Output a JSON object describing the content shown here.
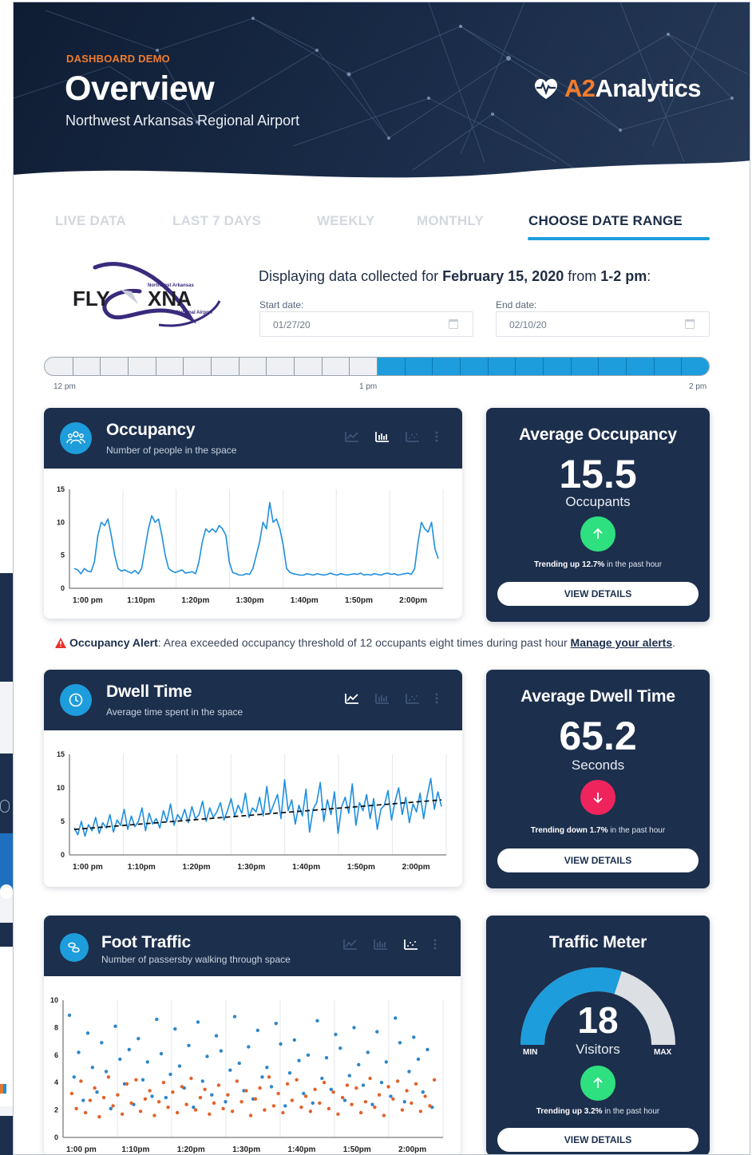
{
  "hero": {
    "eyebrow": "DASHBOARD DEMO",
    "title": "Overview",
    "subtitle": "Northwest Arkansas Regional Airport",
    "brand_prefix": "A2",
    "brand_suffix": "Analytics"
  },
  "tabs": [
    {
      "label": "LIVE DATA",
      "active": false
    },
    {
      "label": "LAST 7 DAYS",
      "active": false
    },
    {
      "label": "WEEKLY",
      "active": false
    },
    {
      "label": "MONTHLY",
      "active": false
    },
    {
      "label": "CHOOSE DATE RANGE",
      "active": true
    }
  ],
  "airport_logo": {
    "wordmark_left": "FLY",
    "wordmark_right": "XNA",
    "line1": "Northwest Arkansas",
    "line2": "National Airport"
  },
  "range": {
    "prefix": "Displaying data collected for ",
    "date": "February 15, 2020",
    "middle": " from ",
    "hours": "1-2 pm",
    "suffix": ":",
    "start_label": "Start date:",
    "start_value": "01/27/20",
    "end_label": "End date:",
    "end_value": "02/10/20"
  },
  "time_slider": {
    "labels": [
      "12 pm",
      "1 pm",
      "2 pm"
    ],
    "segments": 24,
    "selected_from": 12,
    "selected_to": 24
  },
  "occupancy": {
    "title": "Occupancy",
    "subtitle": "Number of people in the space",
    "active_view": "bar-chart",
    "stat_title": "Average Occupancy",
    "stat_value": "15.5",
    "stat_unit": "Occupants",
    "trend_dir": "up",
    "trend_bold": "Trending up 12.7%",
    "trend_rest": " in the past hour",
    "button": "VIEW DETAILS"
  },
  "alert": {
    "label": "Occupancy Alert",
    "text": ": Area exceeded occupancy threshold of 12 occupants eight times during past hour ",
    "link": "Manage your alerts",
    "end": "."
  },
  "dwell": {
    "title": "Dwell Time",
    "subtitle": "Average time spent in the space",
    "active_view": "line-chart",
    "stat_title": "Average Dwell Time",
    "stat_value": "65.2",
    "stat_unit": "Seconds",
    "trend_dir": "down",
    "trend_bold": "Trending down 1.7%",
    "trend_rest": " in the past hour",
    "button": "VIEW DETAILS"
  },
  "foot": {
    "title": "Foot Traffic",
    "subtitle": "Number of passersby walking through space",
    "active_view": "scatter-chart",
    "stat_title": "Traffic Meter",
    "stat_value": "18",
    "stat_unit": "Visitors",
    "gauge_min": "MIN",
    "gauge_max": "MAX",
    "gauge_fraction": 0.6,
    "trend_dir": "up",
    "trend_bold": "Trending up 3.2%",
    "trend_rest": " in the past hour",
    "button": "VIEW DETAILS"
  },
  "colors": {
    "navy": "#1c2f4d",
    "accent_blue": "#1d9ddb",
    "orange": "#f07c2d",
    "up_green": "#2ee07f",
    "down_pink": "#f0245d",
    "scatter_orange": "#e2622a"
  },
  "chart_data": [
    {
      "type": "line",
      "name": "occupancy",
      "x_ticks": [
        "1:00 pm",
        "1:10pm",
        "1:20pm",
        "1:30pm",
        "1:40pm",
        "1:50pm",
        "2:00pm"
      ],
      "y_ticks": [
        0,
        5,
        10,
        15
      ],
      "ylim": [
        0,
        15
      ],
      "series": [
        {
          "values": [
            3,
            2.8,
            2.2,
            3,
            2.6,
            2.5,
            4,
            8,
            10,
            9.5,
            10.5,
            8,
            5,
            3,
            2.6,
            2.8,
            2.5,
            2.3,
            2.7,
            2.2,
            3,
            6,
            9,
            11,
            10,
            10.5,
            8,
            5,
            3,
            2.6,
            2.4,
            2.6,
            2.8,
            2.3,
            2.4,
            2.5,
            2.2,
            4,
            7,
            9,
            8.5,
            9,
            8.5,
            9.5,
            9,
            8,
            4,
            2.4,
            2.2,
            2,
            2,
            2.2,
            2.1,
            3,
            5,
            7,
            10,
            9,
            13,
            10,
            10.5,
            9,
            6.5,
            3,
            2.4,
            2.2,
            2.1,
            2,
            2,
            2.2,
            2.1,
            2,
            2.2,
            2.1,
            2,
            2.1,
            2.3,
            2.1,
            2,
            2.2,
            2.1,
            2,
            2.1,
            2.2,
            2.1,
            2.3,
            2,
            2.1,
            2,
            2.2,
            2.1,
            2,
            2.2,
            2.3,
            2.1,
            2.2,
            2,
            2.1,
            2.2,
            2.3,
            2.1,
            3,
            7,
            10,
            9,
            8.5,
            10,
            6,
            4.5
          ]
        }
      ]
    },
    {
      "type": "line",
      "name": "dwell-time",
      "x_ticks": [
        "1:00 pm",
        "1:10pm",
        "1:20pm",
        "1:30pm",
        "1:40pm",
        "1:50pm",
        "2:00pm"
      ],
      "y_ticks": [
        0,
        5,
        10,
        15
      ],
      "ylim": [
        0,
        15
      ],
      "series": [
        {
          "values": [
            4,
            3,
            5,
            2.8,
            4.5,
            3.6,
            5.6,
            3.2,
            4.8,
            4,
            6,
            3.4,
            5.2,
            4.4,
            6.8,
            3.8,
            5.8,
            4.2,
            5,
            7,
            3.6,
            6.2,
            4.6,
            5.4,
            4,
            6.6,
            5,
            7.6,
            4.4,
            6,
            5.2,
            6.8,
            4.8,
            7.2,
            5.4,
            6,
            8,
            5,
            7,
            5.6,
            6.4,
            7.8,
            5.2,
            6.6,
            8.4,
            5.8,
            7.4,
            6.2,
            9.2,
            5.6,
            7,
            6.4,
            8.6,
            5.8,
            10.2,
            6.2,
            7.6,
            9,
            5.4,
            11.2,
            6.6,
            8.2,
            4.6,
            7.4,
            5.8,
            9.8,
            3.4,
            6.8,
            7.8,
            10.8,
            5,
            8.2,
            6,
            9.4,
            3.2,
            7.2,
            8.6,
            6.2,
            10.6,
            4.4,
            7.8,
            6.6,
            9,
            5.4,
            8.4,
            3.8,
            6.8,
            7.4,
            9.6,
            5.2,
            8,
            10,
            6,
            8.6,
            4.8,
            7.6,
            6.4,
            9.2,
            5.4,
            8.8,
            11.4,
            6.8,
            9.4,
            7.2
          ]
        },
        {
          "values": [
            3.8,
            8.2
          ],
          "style": "dashed-trend"
        }
      ]
    },
    {
      "type": "scatter",
      "name": "foot-traffic",
      "x_ticks": [
        "1:00 pm",
        "1:10pm",
        "1:20pm",
        "1:30pm",
        "1:40pm",
        "1:50pm",
        "2:00pm"
      ],
      "y_ticks": [
        0,
        2,
        4,
        6,
        8,
        10
      ],
      "ylim": [
        0,
        10
      ],
      "series": [
        {
          "color": "blue",
          "values": [
            8.9,
            4.4,
            6.2,
            2.7,
            7.6,
            5.1,
            3.3,
            6.9,
            4.8,
            2.1,
            8.1,
            5.7,
            3.9,
            6.4,
            2.4,
            7.2,
            4.2,
            5.5,
            3,
            8.6,
            6.1,
            2.9,
            4.6,
            7.9,
            5.2,
            3.6,
            6.7,
            2.2,
            8.4,
            4.1,
            5.9,
            3.1,
            7.4,
            6.3,
            2.6,
            4.9,
            8.8,
            5.4,
            3.4,
            6.6,
            2.8,
            7.8,
            4.4,
            5.1,
            3.7,
            8.3,
            6.8,
            2.3,
            4.7,
            7.1,
            5.6,
            3.2,
            6,
            2.5,
            8.5,
            4.3,
            5.8,
            3.5,
            7.5,
            6.5,
            2.7,
            4.5,
            8,
            5.3,
            3.8,
            6.2,
            2.4,
            7.7,
            4,
            5.5,
            3,
            8.7,
            6.9,
            2.6,
            4.8,
            7.3,
            5.7,
            3.3,
            6.4,
            2.2
          ]
        },
        {
          "color": "orange",
          "values": [
            3.2,
            2.1,
            4.1,
            1.8,
            2.7,
            3.6,
            1.5,
            2.9,
            4.4,
            2.3,
            3.1,
            1.7,
            3.9,
            2.5,
            4.2,
            1.9,
            2.8,
            3.4,
            1.6,
            2.6,
            4,
            2.2,
            3.3,
            1.8,
            3.7,
            2.4,
            4.3,
            2,
            2.9,
            3.5,
            1.7,
            2.5,
            3.8,
            2.1,
            3.1,
            1.9,
            4.1,
            2.6,
            3.4,
            1.6,
            2.8,
            3.6,
            2,
            4.4,
            2.3,
            3.2,
            1.8,
            3.9,
            2.7,
            4.2,
            2.2,
            3,
            1.9,
            3.5,
            2.5,
            4,
            2.1,
            3.3,
            1.7,
            2.9,
            3.8,
            2.4,
            3.6,
            1.8,
            2.6,
            4.3,
            2.2,
            3.1,
            1.6,
            3.7,
            2.8,
            4.1,
            2,
            3.4,
            2.5,
            3.9,
            1.9,
            3,
            2.3,
            4.2
          ]
        }
      ]
    }
  ]
}
